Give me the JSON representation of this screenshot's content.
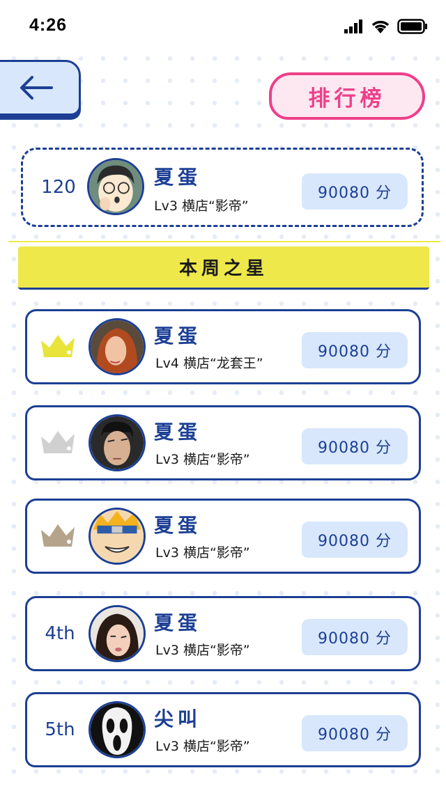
{
  "status": {
    "time": "4:26"
  },
  "header": {
    "title": "排行榜"
  },
  "my_rank": {
    "rank": "120",
    "name": "夏蛋",
    "level": "Lv3 横店“影帝”",
    "score": "90080 分"
  },
  "section": {
    "title": "本周之星"
  },
  "ranking": [
    {
      "name": "夏蛋",
      "level": "Lv4 横店“龙套王”",
      "score": "90080 分",
      "crown": "gold-crown-icon",
      "crown_color": "#e8e43a"
    },
    {
      "name": "夏蛋",
      "level": "Lv3 横店“影帝”",
      "score": "90080 分",
      "crown": "silver-crown-icon",
      "crown_color": "#d0d0d0"
    },
    {
      "name": "夏蛋",
      "level": "Lv3 横店“影帝”",
      "score": "90080 分",
      "crown": "bronze-crown-icon",
      "crown_color": "#b5a38c"
    },
    {
      "rank": "4th",
      "name": "夏蛋",
      "level": "Lv3 横店“影帝”",
      "score": "90080 分"
    },
    {
      "rank": "5th",
      "name": "尖叫",
      "level": "Lv3 横店“影帝”",
      "score": "90080 分"
    }
  ],
  "colors": {
    "primary": "#1c3f94",
    "accent": "#ee3f8a",
    "highlight": "#eee84a",
    "badge": "#d8e7fb"
  }
}
